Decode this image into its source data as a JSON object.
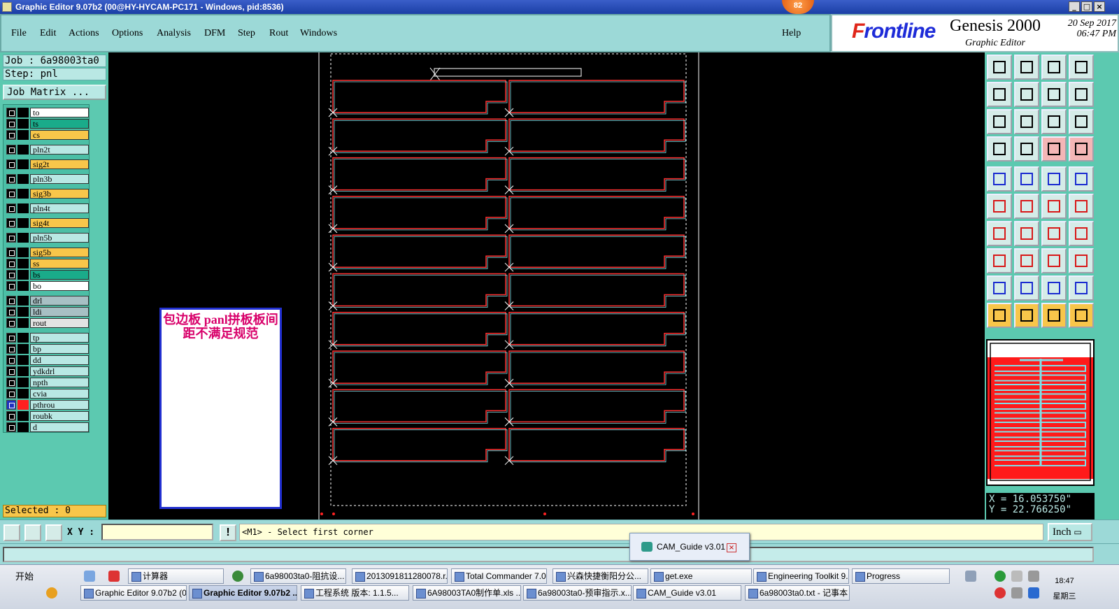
{
  "window": {
    "title": "Graphic Editor 9.07b2 (00@HY-HYCAM-PC171 - Windows, pid:8536)",
    "badge": "82"
  },
  "menu": [
    "File",
    "Edit",
    "Actions",
    "Options",
    "Analysis",
    "DFM",
    "Step",
    "Rout",
    "Windows"
  ],
  "help": "Help",
  "brand": {
    "logo_prefix": "F",
    "logo_rest": "rontline",
    "product": "Genesis 2000",
    "subtitle": "Graphic Editor",
    "date": "20  Sep  2017",
    "time": "06:47  PM"
  },
  "job": "Job : 6a98003ta0",
  "step": "Step: pnl",
  "job_matrix": "Job Matrix ...",
  "layers": [
    {
      "name": "to",
      "color": "#ffffff"
    },
    {
      "name": "ts",
      "color": "#1aab8a"
    },
    {
      "name": "cs",
      "color": "#f8c64a"
    },
    {
      "name": "pln2t",
      "color": "#b9e8e4"
    },
    {
      "name": "sig2t",
      "color": "#f8c64a"
    },
    {
      "name": "pln3b",
      "color": "#b9e8e4"
    },
    {
      "name": "sig3b",
      "color": "#f8c64a"
    },
    {
      "name": "pln4t",
      "color": "#b9e8e4"
    },
    {
      "name": "sig4t",
      "color": "#f8c64a"
    },
    {
      "name": "pln5b",
      "color": "#b9e8e4"
    },
    {
      "name": "sig5b",
      "color": "#f8c64a"
    },
    {
      "name": "ss",
      "color": "#f8c64a"
    },
    {
      "name": "bs",
      "color": "#1aab8a"
    },
    {
      "name": "bo",
      "color": "#ffffff"
    },
    {
      "name": "drl",
      "color": "#a7c0c4"
    },
    {
      "name": "ldi",
      "color": "#a7c0c4"
    },
    {
      "name": "rout",
      "color": "#e3e3e3"
    },
    {
      "name": "tp",
      "color": "#b9e8e4"
    },
    {
      "name": "bp",
      "color": "#b9e8e4"
    },
    {
      "name": "dd",
      "color": "#b9e8e4"
    },
    {
      "name": "ydkdrl",
      "color": "#b9e8e4"
    },
    {
      "name": "npth",
      "color": "#b9e8e4"
    },
    {
      "name": "cvia",
      "color": "#b9e8e4"
    },
    {
      "name": "pthrou",
      "color": "#b9e8e4"
    },
    {
      "name": "roubk",
      "color": "#b9e8e4"
    },
    {
      "name": "d",
      "color": "#b9e8e4"
    }
  ],
  "selected": "Selected : 0",
  "note": "包边板  panl拼板板间距不满足规范",
  "coords": {
    "x": "X = 16.053750\"",
    "y": "Y = 22.766250\""
  },
  "cmd": {
    "xy_label": "X Y :",
    "xy_value": "",
    "exclamation": "!",
    "prompt": "<M1> - Select first corner",
    "unit": "Inch"
  },
  "cam_guide": "CAM_Guide v3.01",
  "taskbar": {
    "start": "开始",
    "row1": [
      "计算器",
      "6a98003ta0-阻抗设...",
      "2013091811280078.r...",
      "Total Commander 7.0...",
      "兴森快捷衡阳分公...",
      "get.exe",
      "Engineering Toolkit 9....",
      "Progress"
    ],
    "row2": [
      "Graphic Editor 9.07b2 (0...",
      "Graphic Editor 9.07b2 ...",
      "工程系统   版本: 1.1.5...",
      "6A98003TA0制作单.xls ...",
      "6a98003ta0-预审指示.x...",
      "CAM_Guide v3.01",
      "6a98003ta0.txt - 记事本"
    ],
    "time": "18:47",
    "day": "星期三"
  }
}
